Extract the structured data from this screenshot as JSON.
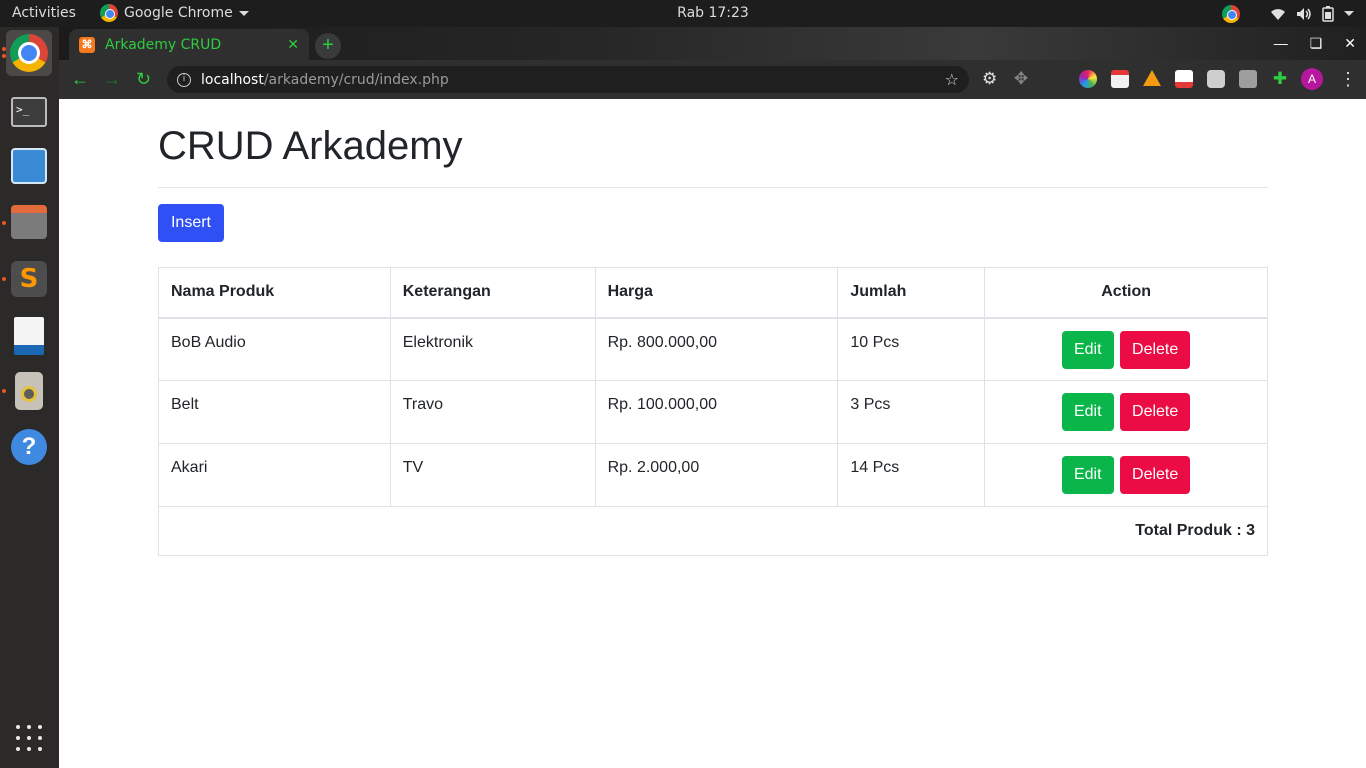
{
  "topbar": {
    "activities": "Activities",
    "app_name": "Google Chrome",
    "clock": "Rab 17:23"
  },
  "browser": {
    "tab_title": "Arkademy CRUD",
    "tab_favicon_text": "⌘",
    "new_tab": "+",
    "url_host": "localhost",
    "url_path": "/arkademy/crud/index.php",
    "profile_initial": "A"
  },
  "page": {
    "title": "CRUD Arkademy",
    "insert_label": "Insert",
    "columns": [
      "Nama Produk",
      "Keterangan",
      "Harga",
      "Jumlah",
      "Action"
    ],
    "rows": [
      {
        "name": "BoB Audio",
        "desc": "Elektronik",
        "price": "Rp. 800.000,00",
        "qty": "10 Pcs"
      },
      {
        "name": "Belt",
        "desc": "Travo",
        "price": "Rp. 100.000,00",
        "qty": "3 Pcs"
      },
      {
        "name": "Akari",
        "desc": "TV",
        "price": "Rp. 2.000,00",
        "qty": "14 Pcs"
      }
    ],
    "edit_label": "Edit",
    "delete_label": "Delete",
    "total_label": "Total Produk : 3"
  },
  "colors": {
    "insert": "#2f50f5",
    "edit": "#0ab54a",
    "delete": "#eb0b45",
    "tab_text": "#2ecc40"
  }
}
